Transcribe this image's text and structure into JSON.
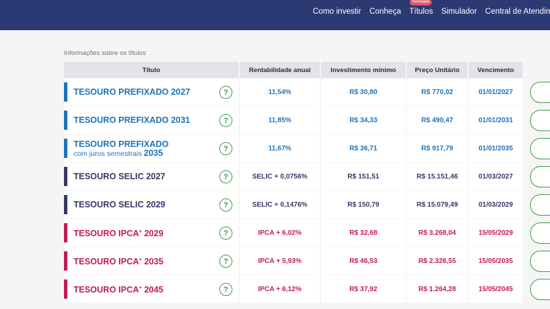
{
  "nav": {
    "items": [
      "Como investir",
      "Conheça",
      "Títulos",
      "Simulador",
      "Central de Atendimen"
    ],
    "badge": "Novidade"
  },
  "section_label": "Informações sobre os títulos",
  "table": {
    "headers": [
      "Título",
      "Rentabilidade anual",
      "Investimento mínimo",
      "Preço Unitário",
      "Vencimento"
    ],
    "help_symbol": "?",
    "colors": {
      "prefixado": "#1f73b7",
      "selic": "#353a63",
      "ipca": "#c21a5b"
    },
    "rows": [
      {
        "name": "TESOURO PREFIXADO",
        "sup": "",
        "sub": "",
        "year": "2027",
        "rate": "11,54%",
        "min": "R$ 30,80",
        "price": "R$ 770,02",
        "maturity": "01/01/2027",
        "type": "pref"
      },
      {
        "name": "TESOURO PREFIXADO",
        "sup": "",
        "sub": "",
        "year": "2031",
        "rate": "11,85%",
        "min": "R$ 34,33",
        "price": "R$ 490,47",
        "maturity": "01/01/2031",
        "type": "pref"
      },
      {
        "name": "TESOURO PREFIXADO",
        "sup": "",
        "sub": "com juros semestrais",
        "year": "2035",
        "rate": "11,67%",
        "min": "R$ 36,71",
        "price": "R$ 917,79",
        "maturity": "01/01/2035",
        "type": "pref"
      },
      {
        "name": "TESOURO SELIC",
        "sup": "",
        "sub": "",
        "year": "2027",
        "rate": "SELIC + 0,0756%",
        "min": "R$ 151,51",
        "price": "R$ 15.151,46",
        "maturity": "01/03/2027",
        "type": "selic"
      },
      {
        "name": "TESOURO SELIC",
        "sup": "",
        "sub": "",
        "year": "2029",
        "rate": "SELIC + 0,1476%",
        "min": "R$ 150,79",
        "price": "R$ 15.079,49",
        "maturity": "01/03/2029",
        "type": "selic"
      },
      {
        "name": "TESOURO IPCA",
        "sup": "+",
        "sub": "",
        "year": "2029",
        "rate": "IPCA + 6,02%",
        "min": "R$ 32,68",
        "price": "R$ 3.268,04",
        "maturity": "15/05/2029",
        "type": "ipca"
      },
      {
        "name": "TESOURO IPCA",
        "sup": "+",
        "sub": "",
        "year": "2035",
        "rate": "IPCA + 5,93%",
        "min": "R$ 46,53",
        "price": "R$ 2.326,55",
        "maturity": "15/05/2035",
        "type": "ipca"
      },
      {
        "name": "TESOURO IPCA",
        "sup": "+",
        "sub": "",
        "year": "2045",
        "rate": "IPCA + 6,12%",
        "min": "R$ 37,92",
        "price": "R$ 1.264,28",
        "maturity": "15/05/2045",
        "type": "ipca"
      }
    ]
  }
}
